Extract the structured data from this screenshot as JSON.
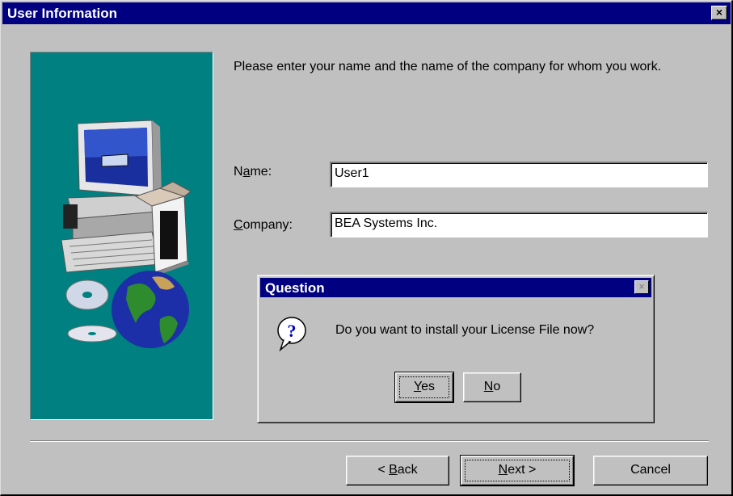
{
  "window": {
    "title": "User Information",
    "close_glyph": "×"
  },
  "instructions": "Please enter your name and the name of the company for whom you work.",
  "fields": {
    "name": {
      "label_pre": "N",
      "label_accel": "a",
      "label_post": "me:",
      "value": "User1"
    },
    "company": {
      "label_pre": "",
      "label_accel": "C",
      "label_post": "ompany:",
      "value": "BEA Systems Inc."
    }
  },
  "side_image": {
    "icon": "computer-with-cds-and-globe-illustration"
  },
  "buttons": {
    "back": {
      "pre": "< ",
      "accel": "B",
      "post": "ack"
    },
    "next": {
      "pre": "",
      "accel": "N",
      "post": "ext >"
    },
    "cancel": {
      "label": "Cancel"
    }
  },
  "question_dialog": {
    "title": "Question",
    "close_glyph": "×",
    "icon": "question-balloon-icon",
    "message": "Do you want to install your License File now?",
    "yes": {
      "accel": "Y",
      "post": "es"
    },
    "no": {
      "accel": "N",
      "post": "o"
    }
  },
  "colors": {
    "title_bar": "#000080",
    "face": "#c0c0c0",
    "side_panel": "#008080"
  }
}
